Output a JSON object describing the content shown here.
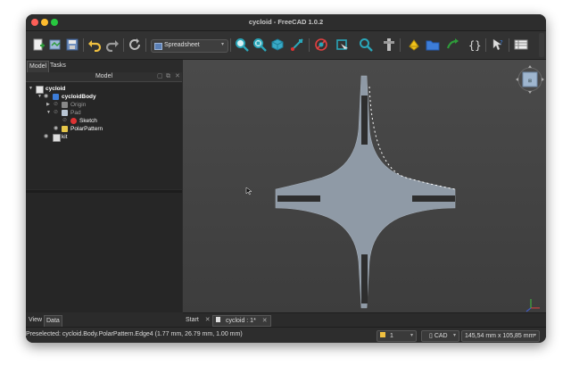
{
  "window": {
    "title": "cycloid - FreeCAD 1.0.2"
  },
  "toolbar": {
    "workbench_selector": "Spreadsheet",
    "icons": [
      "new-file-icon",
      "open-file-icon",
      "save-icon",
      "undo-icon",
      "redo-icon",
      "refresh-icon",
      "fit-all-icon",
      "fit-selection-icon",
      "view-cube-icon",
      "measure-icon",
      "draw-style-icon",
      "stereo-icon",
      "zoom-icon",
      "part-icon",
      "part-design-icon",
      "folder-icon",
      "link-icon",
      "macro-icon",
      "whats-this-icon",
      "spreadsheet-icon"
    ]
  },
  "panel": {
    "tab_model": "Model",
    "tab_tasks": "Tasks",
    "header": "Model",
    "tab_view": "View",
    "tab_data": "Data"
  },
  "tree": {
    "document": "cycloid",
    "body": "cycloidBody",
    "origin": "Origin",
    "pad": "Pad",
    "sketch": "Sketch",
    "polar_pattern": "PolarPattern",
    "kit": "kit"
  },
  "document_tabs": {
    "start": "Start",
    "cycloid": "cycloid : 1*"
  },
  "statusbar": {
    "message": "Preselected: cycloid.Body.PolarPattern.Edge4 (1.77 mm, 26.79 mm, 1.00 mm)",
    "page_value": "1",
    "nav_style": "CAD",
    "dimensions": "145,54 mm x 105,85 mm"
  },
  "colors": {
    "shape_fill": "#8f9aa6",
    "viewport_bg": "#454545",
    "accent": "#3a7bd5"
  }
}
